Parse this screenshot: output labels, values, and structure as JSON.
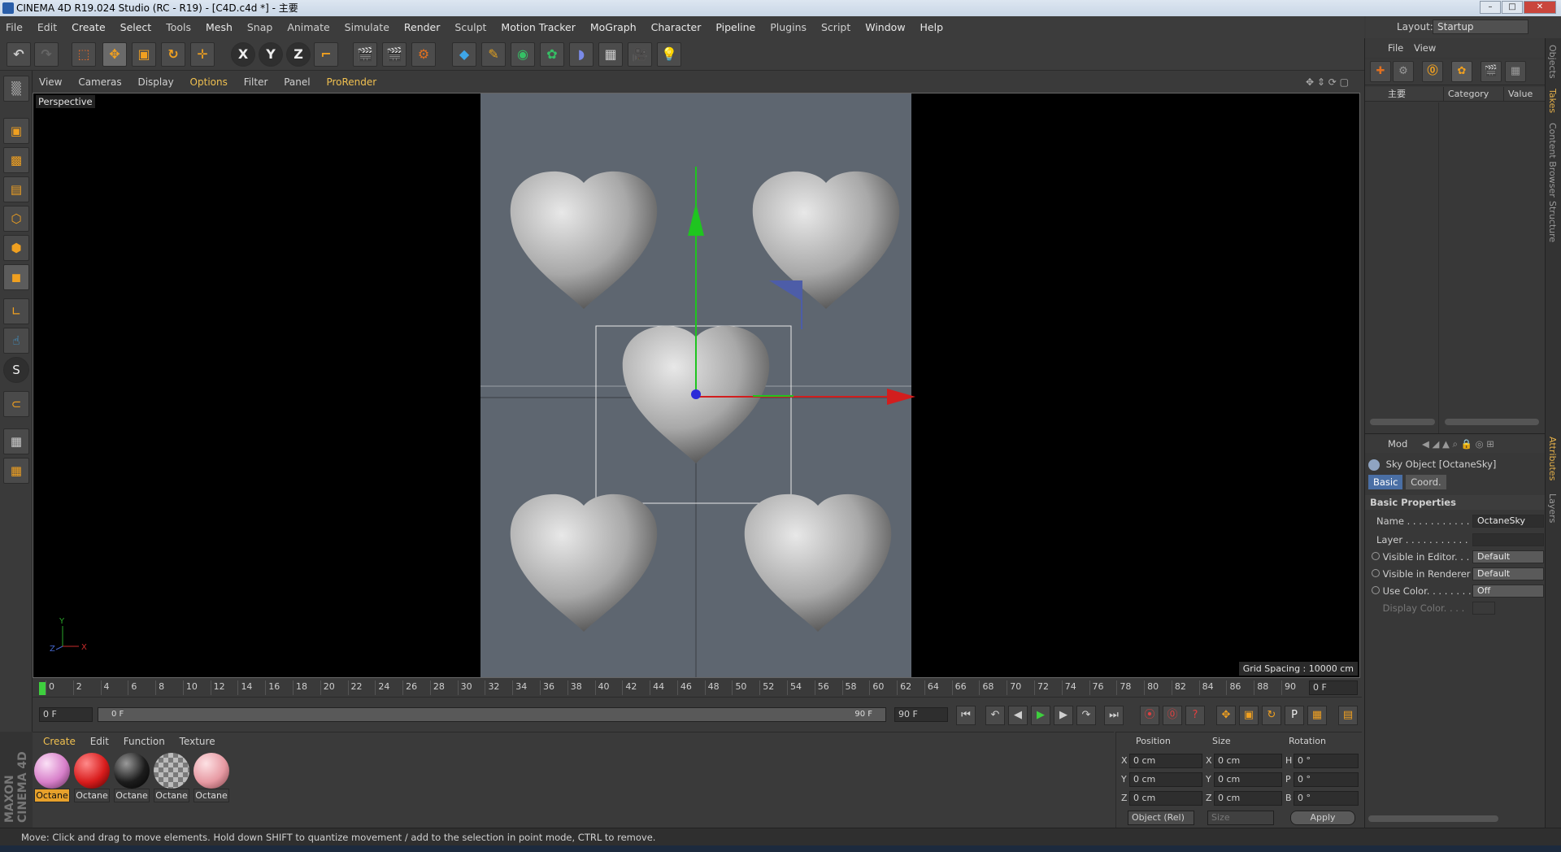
{
  "window": {
    "title": "CINEMA 4D R19.024 Studio (RC - R19) - [C4D.c4d *] - 主要",
    "min": "–",
    "max": "□",
    "close": "✕"
  },
  "menubar": {
    "items": [
      "File",
      "Edit",
      "Create",
      "Select",
      "Tools",
      "Mesh",
      "Snap",
      "Animate",
      "Simulate",
      "Render",
      "Sculpt",
      "Motion Tracker",
      "MoGraph",
      "Character",
      "Pipeline",
      "Plugins",
      "Script",
      "Window",
      "Help"
    ]
  },
  "layout": {
    "label": "Layout:",
    "value": "Startup"
  },
  "toolbar": {
    "axis_x": "X",
    "axis_y": "Y",
    "axis_z": "Z"
  },
  "viewport_menu": {
    "items": [
      "View",
      "Cameras",
      "Display",
      "Options",
      "Filter",
      "Panel",
      "ProRender"
    ]
  },
  "viewport": {
    "label": "Perspective",
    "grid_spacing": "Grid Spacing : 10000 cm",
    "axis_y": "Y",
    "axis_x": "X",
    "axis_z": "Z"
  },
  "timeline": {
    "ticks": [
      "0",
      "2",
      "4",
      "6",
      "8",
      "10",
      "12",
      "14",
      "16",
      "18",
      "20",
      "22",
      "24",
      "26",
      "28",
      "30",
      "32",
      "34",
      "36",
      "38",
      "40",
      "42",
      "44",
      "46",
      "48",
      "50",
      "52",
      "54",
      "56",
      "58",
      "60",
      "62",
      "64",
      "66",
      "68",
      "70",
      "72",
      "74",
      "76",
      "78",
      "80",
      "82",
      "84",
      "86",
      "88",
      "90"
    ],
    "end_field": "0 F"
  },
  "transport": {
    "start": "0 F",
    "range_start": "0 F",
    "range_end": "90 F",
    "end": "90 F"
  },
  "materials": {
    "menu": [
      "Create",
      "Edit",
      "Function",
      "Texture"
    ],
    "items": [
      {
        "label": "Octane",
        "color": "#d77fc9",
        "selected": true
      },
      {
        "label": "Octane",
        "color": "#d81c1c",
        "selected": false
      },
      {
        "label": "Octane",
        "color": "#1c1c1c",
        "selected": false
      },
      {
        "label": "Octane",
        "color": "#9a9a9a",
        "selected": false
      },
      {
        "label": "Octane",
        "color": "#e79aa3",
        "selected": false
      }
    ],
    "brand": "MAXON CINEMA 4D"
  },
  "coords": {
    "headers": [
      "Position",
      "Size",
      "Rotation"
    ],
    "rows": [
      {
        "axis": "X",
        "pos": "0 cm",
        "size_axis": "X",
        "size": "0 cm",
        "rot_axis": "H",
        "rot": "0 °"
      },
      {
        "axis": "Y",
        "pos": "0 cm",
        "size_axis": "Y",
        "size": "0 cm",
        "rot_axis": "P",
        "rot": "0 °"
      },
      {
        "axis": "Z",
        "pos": "0 cm",
        "size_axis": "Z",
        "size": "0 cm",
        "rot_axis": "B",
        "rot": "0 °"
      }
    ],
    "mode": "Object (Rel)",
    "size_mode": "Size",
    "apply": "Apply"
  },
  "objects_panel": {
    "menu": [
      "File",
      "View"
    ],
    "columns": [
      "主要",
      "Category",
      "Value"
    ]
  },
  "attributes": {
    "menu": "Mod",
    "object": "Sky Object [OctaneSky]",
    "tabs": [
      "Basic",
      "Coord."
    ],
    "section": "Basic Properties",
    "props": [
      {
        "label": "Name . . . . . . . . . . .",
        "value": "OctaneSky"
      },
      {
        "label": "Layer . . . . . . . . . . .",
        "value": ""
      },
      {
        "label": "Visible in Editor. . .",
        "value": "Default"
      },
      {
        "label": "Visible in Renderer",
        "value": "Default"
      },
      {
        "label": "Use Color. . . . . . . .",
        "value": "Off"
      },
      {
        "label": "Display Color. . . .",
        "value": ""
      }
    ]
  },
  "side_tabs": [
    "Objects",
    "Takes",
    "Content Browser",
    "Structure",
    "Attributes",
    "Layers"
  ],
  "status": "Move: Click and drag to move elements. Hold down SHIFT to quantize movement / add to the selection in point mode, CTRL to remove."
}
